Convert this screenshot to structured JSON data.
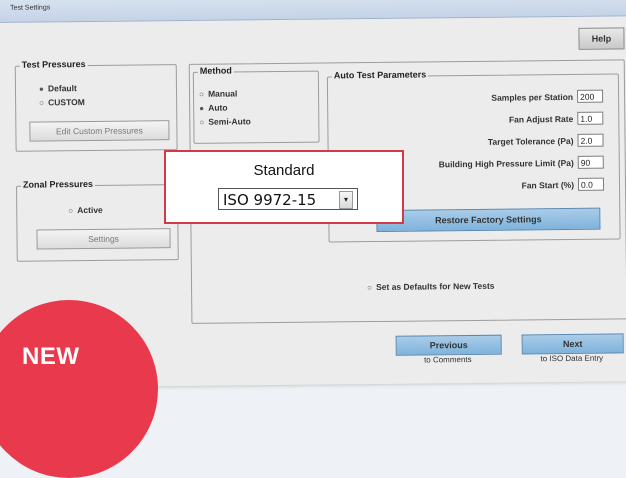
{
  "window": {
    "title": "Test Settings"
  },
  "header": {
    "help_label": "Help"
  },
  "test_pressures": {
    "title": "Test Pressures",
    "options": [
      {
        "label": "Default",
        "selected": true
      },
      {
        "label": "CUSTOM",
        "selected": false
      }
    ],
    "edit_button": "Edit Custom Pressures"
  },
  "zonal_pressures": {
    "title": "Zonal Pressures",
    "active_label": "Active",
    "settings_button": "Settings"
  },
  "method": {
    "title": "Method",
    "options": [
      {
        "label": "Manual",
        "selected": false
      },
      {
        "label": "Auto",
        "selected": true
      },
      {
        "label": "Semi-Auto",
        "selected": false
      }
    ]
  },
  "auto_test": {
    "title": "Auto Test Parameters",
    "params": [
      {
        "label": "Samples per Station",
        "value": "200"
      },
      {
        "label": "Fan Adjust Rate",
        "value": "1.0"
      },
      {
        "label": "Target Tolerance (Pa)",
        "value": "2.0"
      },
      {
        "label": "Building High Pressure Limit (Pa)",
        "value": "90"
      },
      {
        "label": "Fan Start (%)",
        "value": "0.0"
      }
    ],
    "restore_button": "Restore Factory Settings"
  },
  "standard": {
    "title": "Standard",
    "value": "ISO 9972-15"
  },
  "defaults_checkbox": "Set as Defaults for New Tests",
  "nav": {
    "previous": {
      "label": "Previous",
      "sub": "to Comments"
    },
    "next": {
      "label": "Next",
      "sub": "to ISO Data Entry"
    }
  },
  "badge": {
    "text": "NEW",
    "color": "#e83a4c"
  },
  "colors": {
    "accent_blue": "#7fb3dc",
    "callout_border": "#d33a47"
  }
}
